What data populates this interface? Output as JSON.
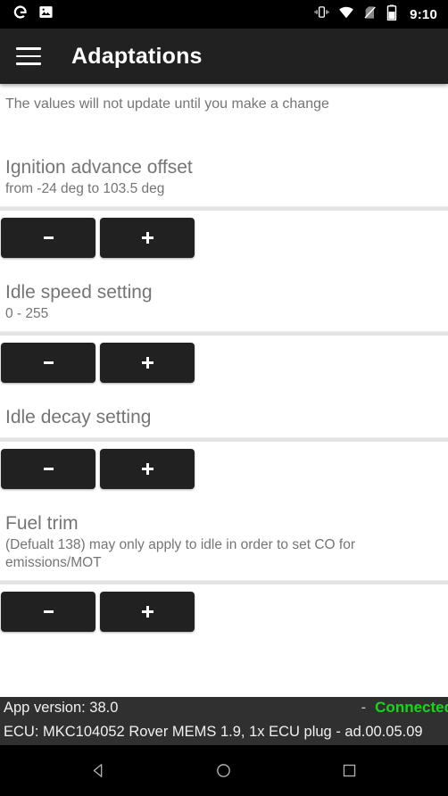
{
  "status_bar": {
    "icons": [
      "google-g-icon",
      "photos-icon",
      "vibrate-icon",
      "wifi-icon",
      "no-sim-icon",
      "battery-icon"
    ],
    "clock": "9:10"
  },
  "app_bar": {
    "menu_icon": "hamburger-menu-icon",
    "title": "Adaptations"
  },
  "content": {
    "notice": "The values will not update until you make a change",
    "sections": [
      {
        "title": "Ignition advance offset",
        "subtitle": "from -24 deg to 103.5 deg",
        "decrement_label": "-",
        "increment_label": "+"
      },
      {
        "title": "Idle speed setting",
        "subtitle": "0 - 255",
        "decrement_label": "-",
        "increment_label": "+"
      },
      {
        "title": "Idle decay setting",
        "subtitle": "",
        "decrement_label": "-",
        "increment_label": "+"
      },
      {
        "title": "Fuel trim",
        "subtitle": "(Defualt 138) may only apply to idle in order to set CO for emissions/MOT",
        "decrement_label": "-",
        "increment_label": "+"
      }
    ]
  },
  "status_strip": {
    "app_version": "App version: 38.0",
    "separator": "-",
    "connection_status": "Connected",
    "connection_color": "#1ad61a",
    "ecu_info": "ECU: MKC104052 Rover MEMS 1.9, 1x ECU plug - ad.00.05.09"
  },
  "nav_bar": {
    "back": "back-icon",
    "home": "home-icon",
    "recents": "recents-icon"
  }
}
